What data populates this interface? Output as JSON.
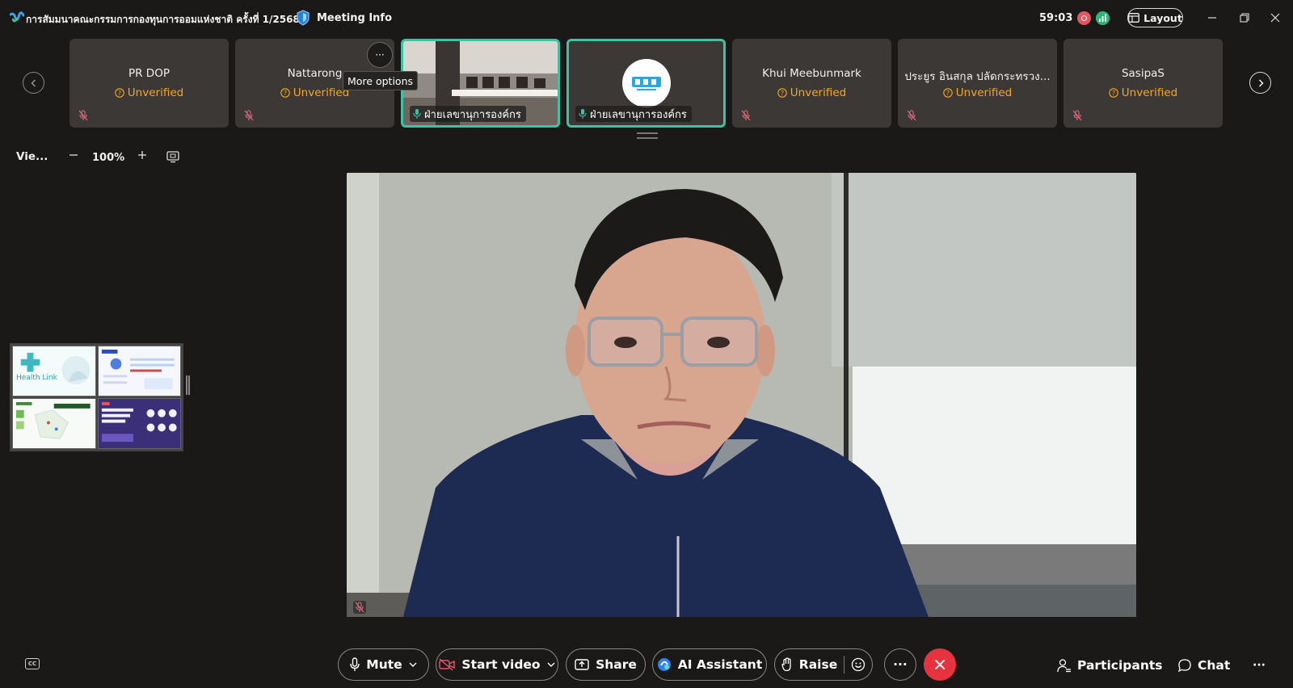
{
  "titlebar": {
    "meeting_title": "การสัมมนาคณะกรรมการกองทุนการออมแห่งชาติ ครั้งที่ 1/2568",
    "meeting_info": "Meeting Info",
    "timer": "59:03",
    "layout_label": "Layout",
    "icons": [
      "webex-logo-icon",
      "shield-icon",
      "record-icon",
      "signal-icon",
      "layout-icon",
      "minimize-icon",
      "restore-icon",
      "close-icon"
    ]
  },
  "participants": [
    {
      "name": "PR DOP",
      "status": "Unverified",
      "muted": true
    },
    {
      "name": "Nattarong",
      "status": "Unverified",
      "muted": true
    },
    {
      "name": "",
      "label": "ฝ่ายเลขานุการองค์กร",
      "video": true,
      "active": true
    },
    {
      "name": "",
      "label": "ฝ่ายเลขานุการองค์กร",
      "logo": true,
      "active": true
    },
    {
      "name": "Khui Meebunmark",
      "status": "Unverified",
      "muted": true
    },
    {
      "name": "ประยูร อินสกุล ปลัดกระทรวง...",
      "status": "Unverified",
      "muted": true
    },
    {
      "name": "SasipaS",
      "status": "Unverified",
      "muted": true
    }
  ],
  "more_options_tooltip": "More options",
  "view_toolbar": {
    "view_label": "Vie...",
    "zoom": "100%"
  },
  "thumbnails": {
    "t1_text": "Health Link"
  },
  "controls": {
    "mute": "Mute",
    "start_video": "Start video",
    "share": "Share",
    "ai_assistant": "AI Assistant",
    "raise": "Raise",
    "participants": "Participants",
    "chat": "Chat"
  },
  "colors": {
    "background": "#1b1918",
    "tile": "#3c3836",
    "active_border": "#3fc1a3",
    "unverified": "#f5a623",
    "end_call": "#e7323f"
  }
}
